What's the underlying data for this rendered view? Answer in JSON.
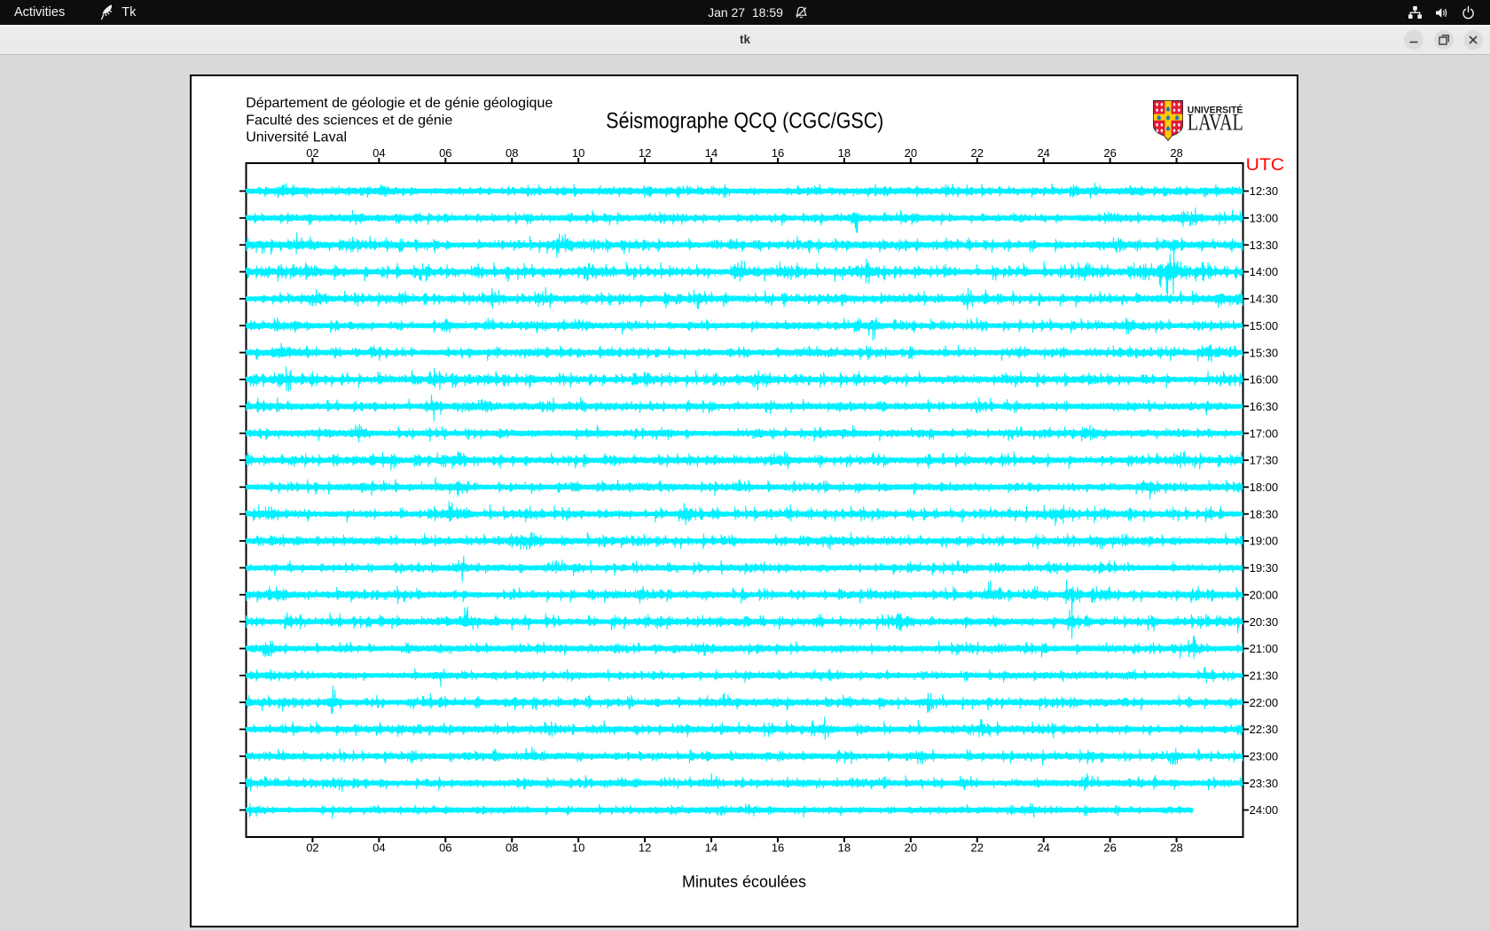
{
  "desktop": {
    "top_bar": {
      "activities_label": "Activities",
      "app_indicator": "Tk",
      "clock": "Jan 27  18:59",
      "status_icons": [
        "network",
        "volume",
        "power"
      ]
    },
    "window": {
      "title": "tk",
      "controls": [
        "minimize",
        "restore",
        "close"
      ]
    }
  },
  "canvas": {
    "header_lines": [
      "Département de géologie et de génie géologique",
      "Faculté des sciences et de génie",
      "Université Laval"
    ],
    "title": "Séismographe QCQ (CGC/GSC)",
    "utc_label": "UTC",
    "xlabel": "Minutes écoulées",
    "logo": {
      "word_top": "UNIVERSITÉ",
      "word_bottom": "LAVAL",
      "shield_red": "#e31837",
      "shield_gold": "#ffcb05",
      "shield_blue": "#2178c4",
      "text_color": "#1a1a1a"
    },
    "colors": {
      "trace": "#00f0ff",
      "axis": "#000000",
      "utc": "#ff0000",
      "text": "#000000"
    }
  },
  "chart_data": {
    "type": "line",
    "title": "Séismographe QCQ (CGC/GSC)",
    "xlabel": "Minutes écoulées",
    "x_range_minutes": [
      0,
      30
    ],
    "x_ticks": [
      "02",
      "04",
      "06",
      "08",
      "10",
      "12",
      "14",
      "16",
      "18",
      "20",
      "22",
      "24",
      "26",
      "28"
    ],
    "x_tick_minutes": [
      2,
      4,
      6,
      8,
      10,
      12,
      14,
      16,
      18,
      20,
      22,
      24,
      26,
      28
    ],
    "right_axis_title": "UTC",
    "grid": false,
    "legend": null,
    "traces": [
      {
        "label": "12:30",
        "amp": 2.2,
        "sp": 0.035,
        "spA": 5,
        "end": 30,
        "seed": 11,
        "ev": [
          {
            "m": 1.4,
            "a": 6,
            "w": 0.5
          },
          {
            "m": 4.2,
            "a": 5,
            "w": 0.3
          },
          {
            "m": 25.4,
            "a": 7,
            "w": 0.2
          }
        ]
      },
      {
        "label": "13:00",
        "amp": 2.0,
        "sp": 0.03,
        "spA": 5,
        "end": 30,
        "seed": 22,
        "ev": [
          {
            "m": 3.3,
            "a": 7,
            "w": 0.2
          },
          {
            "m": 18.35,
            "a": 15,
            "w": 0.15
          },
          {
            "m": 28.4,
            "a": 8,
            "w": 0.3
          }
        ]
      },
      {
        "label": "13:30",
        "amp": 2.3,
        "sp": 0.04,
        "spA": 6,
        "end": 30,
        "seed": 33,
        "ev": [
          {
            "m": 0.3,
            "a": 8,
            "w": 0.6
          },
          {
            "m": 1.5,
            "a": 9,
            "w": 0.3
          },
          {
            "m": 3.2,
            "a": 7,
            "w": 0.25
          },
          {
            "m": 9.4,
            "a": 9,
            "w": 0.3
          },
          {
            "m": 26.1,
            "a": 7,
            "w": 0.4
          },
          {
            "m": 27.9,
            "a": 6,
            "w": 0.3
          }
        ]
      },
      {
        "label": "14:00",
        "amp": 2.5,
        "sp": 0.05,
        "spA": 7,
        "end": 30,
        "seed": 44,
        "ev": [
          {
            "m": 1.8,
            "a": 8,
            "w": 0.3
          },
          {
            "m": 5.3,
            "a": 8,
            "w": 0.25
          },
          {
            "m": 10.3,
            "a": 8,
            "w": 0.3
          },
          {
            "m": 15.0,
            "a": 11,
            "w": 0.25
          },
          {
            "m": 18.7,
            "a": 9,
            "w": 0.4
          },
          {
            "m": 25.3,
            "a": 9,
            "w": 0.3
          },
          {
            "m": 27.7,
            "a": 22,
            "w": 0.5
          },
          {
            "m": 28.8,
            "a": 9,
            "w": 0.3
          }
        ]
      },
      {
        "label": "14:30",
        "amp": 2.3,
        "sp": 0.04,
        "spA": 6,
        "end": 30,
        "seed": 55,
        "ev": [
          {
            "m": 2.1,
            "a": 9,
            "w": 0.25
          },
          {
            "m": 7.6,
            "a": 8,
            "w": 0.3
          },
          {
            "m": 9.0,
            "a": 12,
            "w": 0.2
          },
          {
            "m": 13.6,
            "a": 10,
            "w": 0.25
          },
          {
            "m": 21.8,
            "a": 8,
            "w": 0.3
          },
          {
            "m": 29.6,
            "a": 6,
            "w": 0.4
          }
        ]
      },
      {
        "label": "15:00",
        "amp": 2.1,
        "sp": 0.03,
        "spA": 5,
        "end": 30,
        "seed": 66,
        "ev": [
          {
            "m": 10.0,
            "a": 6,
            "w": 0.3
          },
          {
            "m": 18.85,
            "a": 15,
            "w": 0.15
          },
          {
            "m": 26.5,
            "a": 6,
            "w": 0.3
          }
        ]
      },
      {
        "label": "15:30",
        "amp": 2.2,
        "sp": 0.035,
        "spA": 5,
        "end": 30,
        "seed": 77,
        "ev": [
          {
            "m": 1.05,
            "a": 9,
            "w": 0.2
          },
          {
            "m": 23.3,
            "a": 6,
            "w": 0.3
          },
          {
            "m": 29.0,
            "a": 7,
            "w": 0.5
          }
        ]
      },
      {
        "label": "16:00",
        "amp": 2.4,
        "sp": 0.045,
        "spA": 6,
        "end": 30,
        "seed": 88,
        "ev": [
          {
            "m": 1.2,
            "a": 13,
            "w": 0.3
          },
          {
            "m": 5.8,
            "a": 8,
            "w": 0.3
          },
          {
            "m": 12.0,
            "a": 7,
            "w": 0.3
          },
          {
            "m": 15.3,
            "a": 8,
            "w": 0.25
          }
        ]
      },
      {
        "label": "16:30",
        "amp": 2.2,
        "sp": 0.035,
        "spA": 5,
        "end": 30,
        "seed": 99,
        "ev": [
          {
            "m": 5.65,
            "a": 15,
            "w": 0.18
          },
          {
            "m": 7.1,
            "a": 7,
            "w": 0.3
          },
          {
            "m": 22.0,
            "a": 7,
            "w": 0.3
          }
        ]
      },
      {
        "label": "17:00",
        "amp": 2.1,
        "sp": 0.03,
        "spA": 5,
        "end": 30,
        "seed": 110,
        "ev": [
          {
            "m": 3.4,
            "a": 9,
            "w": 0.25
          },
          {
            "m": 12.5,
            "a": 6,
            "w": 0.3
          },
          {
            "m": 25.4,
            "a": 7,
            "w": 0.25
          }
        ]
      },
      {
        "label": "17:30",
        "amp": 2.3,
        "sp": 0.04,
        "spA": 6,
        "end": 30,
        "seed": 121,
        "ev": [
          {
            "m": 4.1,
            "a": 8,
            "w": 0.3
          },
          {
            "m": 6.2,
            "a": 8,
            "w": 0.4
          },
          {
            "m": 16.2,
            "a": 8,
            "w": 0.35
          },
          {
            "m": 28.1,
            "a": 8,
            "w": 0.3
          }
        ]
      },
      {
        "label": "18:00",
        "amp": 2.1,
        "sp": 0.03,
        "spA": 5,
        "end": 30,
        "seed": 132,
        "ev": [
          {
            "m": 6.5,
            "a": 6,
            "w": 0.3
          },
          {
            "m": 27.2,
            "a": 12,
            "w": 0.2
          }
        ]
      },
      {
        "label": "18:30",
        "amp": 2.3,
        "sp": 0.04,
        "spA": 6,
        "end": 30,
        "seed": 143,
        "ev": [
          {
            "m": 6.1,
            "a": 13,
            "w": 0.2
          },
          {
            "m": 13.3,
            "a": 7,
            "w": 0.3
          },
          {
            "m": 24.6,
            "a": 9,
            "w": 0.25
          }
        ]
      },
      {
        "label": "19:00",
        "amp": 2.2,
        "sp": 0.035,
        "spA": 5,
        "end": 30,
        "seed": 154,
        "ev": [
          {
            "m": 8.6,
            "a": 9,
            "w": 0.5
          },
          {
            "m": 17.5,
            "a": 6,
            "w": 0.3
          },
          {
            "m": 25.7,
            "a": 7,
            "w": 0.25
          }
        ]
      },
      {
        "label": "19:30",
        "amp": 2.0,
        "sp": 0.03,
        "spA": 5,
        "end": 30,
        "seed": 165,
        "ev": [
          {
            "m": 6.5,
            "a": 14,
            "w": 0.15
          },
          {
            "m": 9.3,
            "a": 6,
            "w": 0.3
          },
          {
            "m": 21.4,
            "a": 6,
            "w": 0.3
          }
        ]
      },
      {
        "label": "20:00",
        "amp": 2.3,
        "sp": 0.04,
        "spA": 6,
        "end": 30,
        "seed": 176,
        "ev": [
          {
            "m": 0.9,
            "a": 8,
            "w": 0.3
          },
          {
            "m": 22.4,
            "a": 14,
            "w": 0.2
          },
          {
            "m": 23.8,
            "a": 8,
            "w": 0.3
          },
          {
            "m": 24.85,
            "a": 24,
            "w": 0.22
          },
          {
            "m": 25.6,
            "a": 8,
            "w": 0.3
          }
        ]
      },
      {
        "label": "20:30",
        "amp": 2.3,
        "sp": 0.04,
        "spA": 6,
        "end": 30,
        "seed": 187,
        "ev": [
          {
            "m": 6.65,
            "a": 16,
            "w": 0.18
          },
          {
            "m": 19.7,
            "a": 8,
            "w": 0.3
          },
          {
            "m": 24.85,
            "a": 18,
            "w": 0.15
          },
          {
            "m": 29.3,
            "a": 6,
            "w": 0.3
          }
        ]
      },
      {
        "label": "21:00",
        "amp": 2.1,
        "sp": 0.03,
        "spA": 5,
        "end": 30,
        "seed": 198,
        "ev": [
          {
            "m": 0.6,
            "a": 7,
            "w": 0.3
          },
          {
            "m": 13.8,
            "a": 6,
            "w": 0.3
          },
          {
            "m": 28.5,
            "a": 13,
            "w": 0.2
          }
        ]
      },
      {
        "label": "21:30",
        "amp": 2.0,
        "sp": 0.028,
        "spA": 4.5,
        "end": 30,
        "seed": 209,
        "ev": [
          {
            "m": 5.85,
            "a": 11,
            "w": 0.18
          },
          {
            "m": 17.3,
            "a": 6,
            "w": 0.3
          },
          {
            "m": 28.9,
            "a": 7,
            "w": 0.25
          }
        ]
      },
      {
        "label": "22:00",
        "amp": 2.2,
        "sp": 0.035,
        "spA": 5.5,
        "end": 30,
        "seed": 220,
        "ev": [
          {
            "m": 2.6,
            "a": 17,
            "w": 0.2
          },
          {
            "m": 14.5,
            "a": 7,
            "w": 0.3
          },
          {
            "m": 20.5,
            "a": 10,
            "w": 0.25
          }
        ]
      },
      {
        "label": "22:30",
        "amp": 2.2,
        "sp": 0.035,
        "spA": 5.5,
        "end": 30,
        "seed": 231,
        "ev": [
          {
            "m": 9.2,
            "a": 7,
            "w": 0.3
          },
          {
            "m": 17.4,
            "a": 13,
            "w": 0.3
          },
          {
            "m": 22.1,
            "a": 10,
            "w": 0.25
          }
        ]
      },
      {
        "label": "23:00",
        "amp": 2.1,
        "sp": 0.03,
        "spA": 5,
        "end": 30,
        "seed": 242,
        "ev": [
          {
            "m": 8.6,
            "a": 9,
            "w": 0.3
          },
          {
            "m": 20.3,
            "a": 7,
            "w": 0.3
          },
          {
            "m": 27.9,
            "a": 8,
            "w": 0.25
          }
        ]
      },
      {
        "label": "23:30",
        "amp": 2.1,
        "sp": 0.03,
        "spA": 5,
        "end": 30,
        "seed": 253,
        "ev": [
          {
            "m": 2.8,
            "a": 7,
            "w": 0.3
          },
          {
            "m": 14.0,
            "a": 9,
            "w": 0.25
          },
          {
            "m": 25.3,
            "a": 10,
            "w": 0.2
          }
        ]
      },
      {
        "label": "24:00",
        "amp": 1.6,
        "sp": 0.02,
        "spA": 4,
        "end": 28.5,
        "seed": 264,
        "ev": [
          {
            "m": 0.3,
            "a": 6,
            "w": 0.2
          },
          {
            "m": 14.3,
            "a": 5,
            "w": 0.25
          },
          {
            "m": 23.6,
            "a": 6,
            "w": 0.2
          }
        ]
      }
    ]
  }
}
